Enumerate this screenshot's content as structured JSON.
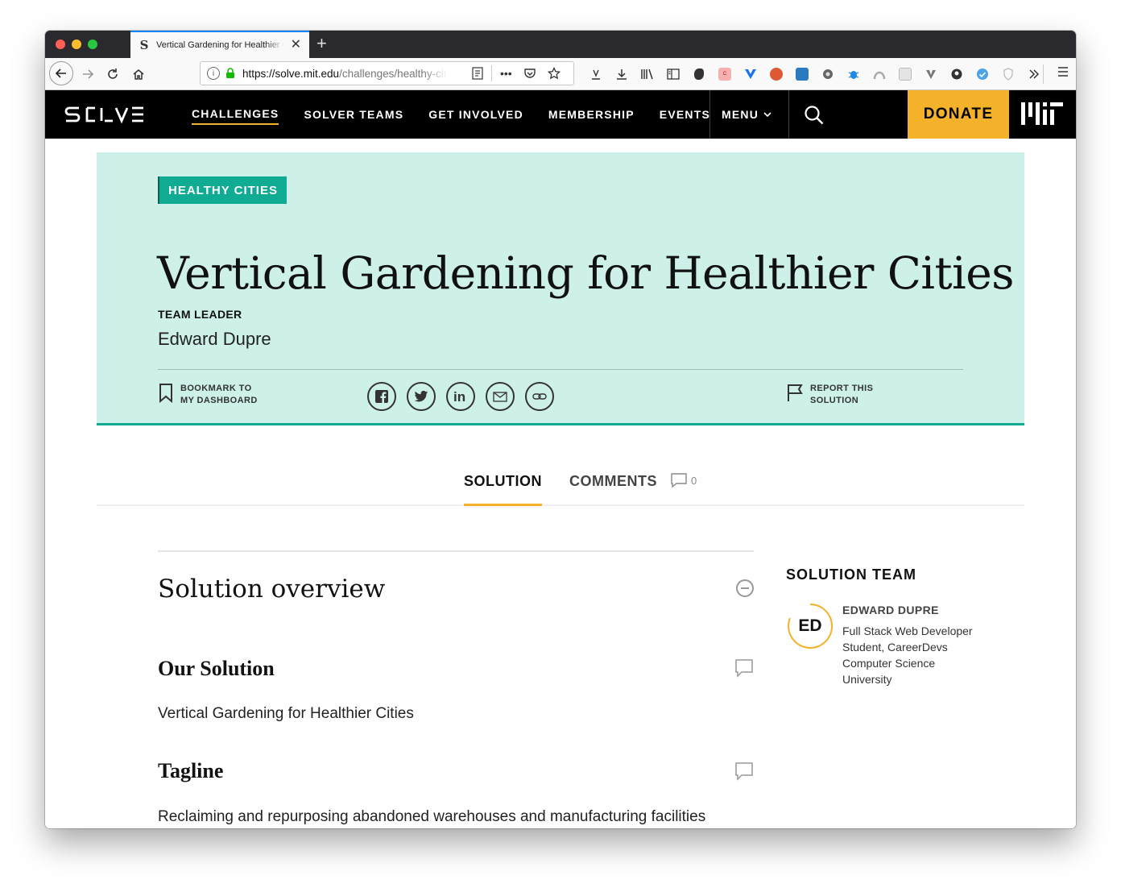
{
  "browser": {
    "tab_title": "Vertical Gardening for Healthier Cities",
    "tab_favicon": "S",
    "url_host": "https://solve.mit.edu",
    "url_path": "/challenges/healthy-cities",
    "toolbar_icons": [
      "library-icon",
      "download-icon",
      "bookshelf-icon",
      "sidebar-icon",
      "evernote-icon",
      "cors-icon",
      "vue-devtools-icon",
      "duckduckgo-icon",
      "swagger-icon",
      "settings-gear-icon",
      "bug-icon",
      "arc-icon",
      "grid-icon",
      "v-icon",
      "github-icon",
      "check-icon",
      "shield-icon",
      "overflow-icon"
    ]
  },
  "site": {
    "logo": "SOLVE",
    "nav": [
      {
        "label": "CHALLENGES",
        "active": true
      },
      {
        "label": "SOLVER TEAMS",
        "active": false
      },
      {
        "label": "GET INVOLVED",
        "active": false
      },
      {
        "label": "MEMBERSHIP",
        "active": false
      },
      {
        "label": "EVENTS",
        "active": false
      }
    ],
    "menu_label": "MENU",
    "donate_label": "DONATE",
    "mit_label": "MIT"
  },
  "hero": {
    "tag": "HEALTHY CITIES",
    "title": "Vertical Gardening for Healthier Cities",
    "leader_label": "TEAM LEADER",
    "leader_name": "Edward Dupre",
    "bookmark_line1": "BOOKMARK TO",
    "bookmark_line2": "MY DASHBOARD",
    "report_line1": "REPORT THIS",
    "report_line2": "SOLUTION",
    "share_icons": [
      "facebook-icon",
      "twitter-icon",
      "linkedin-icon",
      "email-icon",
      "link-icon"
    ]
  },
  "content_tabs": {
    "solution": "SOLUTION",
    "comments": "COMMENTS",
    "comment_count": "0"
  },
  "main": {
    "overview_title": "Solution overview",
    "sections": [
      {
        "heading": "Our Solution",
        "body": "Vertical Gardening for Healthier Cities"
      },
      {
        "heading": "Tagline",
        "body": "Reclaiming and repurposing abandoned warehouses and manufacturing facilities"
      }
    ]
  },
  "sidebar": {
    "title": "SOLUTION TEAM",
    "member": {
      "initials": "ED",
      "name": "EDWARD DUPRE",
      "role": "Full Stack Web Developer Student, CareerDevs Computer Science University"
    }
  },
  "colors": {
    "accent": "#f3b229",
    "teal": "#10ab93",
    "hero_bg": "#cdf0e8",
    "nav_bg": "#000000"
  }
}
